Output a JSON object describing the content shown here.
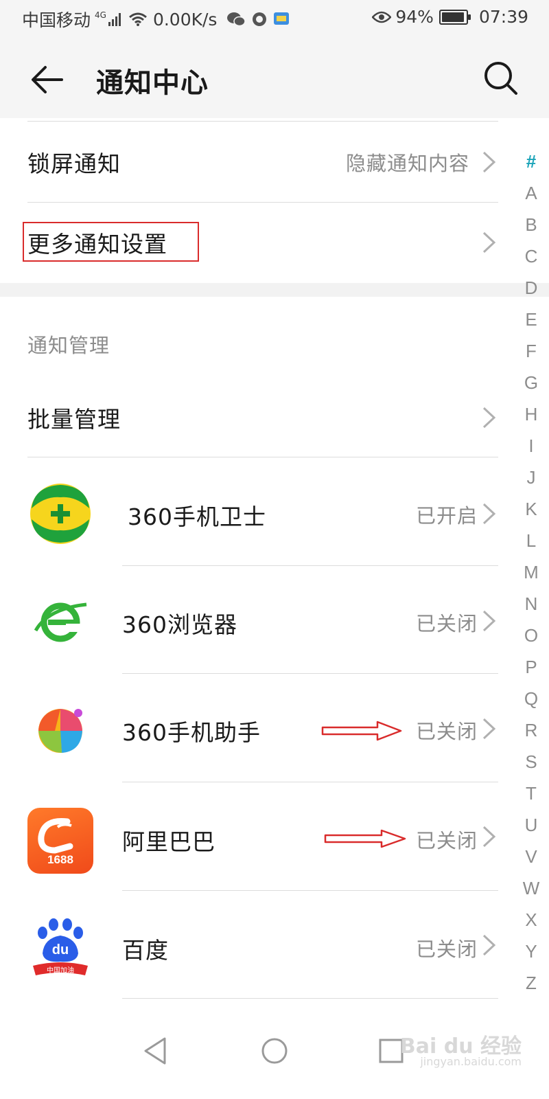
{
  "status_bar": {
    "carrier": "中国移动",
    "network": "4G",
    "speed": "0.00K/s",
    "battery": "94%",
    "battery_level": 0.94,
    "time": "07:39"
  },
  "app_bar": {
    "title": "通知中心",
    "back_icon": "arrow-left-icon",
    "search_icon": "search-icon"
  },
  "settings": {
    "lock_screen_label": "锁屏通知",
    "lock_screen_value": "隐藏通知内容",
    "more_settings_label": "更多通知设置"
  },
  "notification_management": {
    "section_title": "通知管理",
    "batch_label": "批量管理"
  },
  "apps": [
    {
      "name": "360手机卫士",
      "status": "已开启",
      "icon": "360-security-icon"
    },
    {
      "name": "360浏览器",
      "status": "已关闭",
      "icon": "360-browser-icon"
    },
    {
      "name": "360手机助手",
      "status": "已关闭",
      "icon": "360-assistant-icon"
    },
    {
      "name": "阿里巴巴",
      "status": "已关闭",
      "icon": "alibaba-icon",
      "icon_text": "1688"
    },
    {
      "name": "百度",
      "status": "已关闭",
      "icon": "baidu-icon",
      "icon_text": "du",
      "icon_subtext": "中国加油"
    }
  ],
  "index_bar": [
    "#",
    "A",
    "B",
    "C",
    "D",
    "E",
    "F",
    "G",
    "H",
    "I",
    "J",
    "K",
    "L",
    "M",
    "N",
    "O",
    "P",
    "Q",
    "R",
    "S",
    "T",
    "U",
    "V",
    "W",
    "X",
    "Y",
    "Z"
  ],
  "watermark": {
    "text": "Bai du 经验",
    "url_text": "jingyan.baidu.com"
  },
  "colors": {
    "accent": "#1aa3b8",
    "annotation_red": "#d92b2b",
    "secondary_text": "#8c8c8c"
  }
}
